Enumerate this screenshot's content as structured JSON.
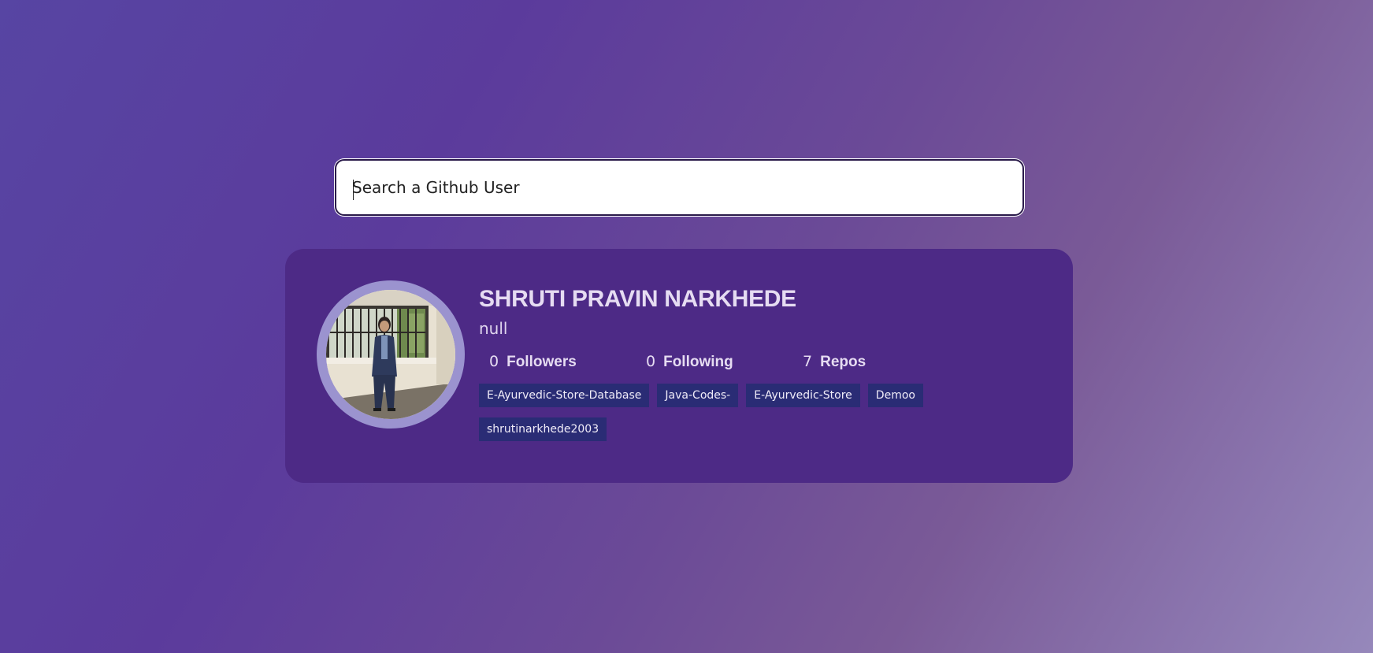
{
  "search": {
    "placeholder": "Search a Github User"
  },
  "profile": {
    "name": "SHRUTI PRAVIN NARKHEDE",
    "bio": "null",
    "stats": {
      "followers_count": "0",
      "followers_label": "Followers",
      "following_count": "0",
      "following_label": "Following",
      "repos_count": "7",
      "repos_label": "Repos"
    },
    "repos": [
      "E-Ayurvedic-Store-Database",
      "Java-Codes-",
      "E-Ayurvedic-Store",
      "Demoo",
      "shrutinarkhede2003"
    ]
  },
  "colors": {
    "card_background": "#4d2a86",
    "repo_tag_background": "#2a2c75",
    "avatar_ring": "#9b93cf"
  }
}
